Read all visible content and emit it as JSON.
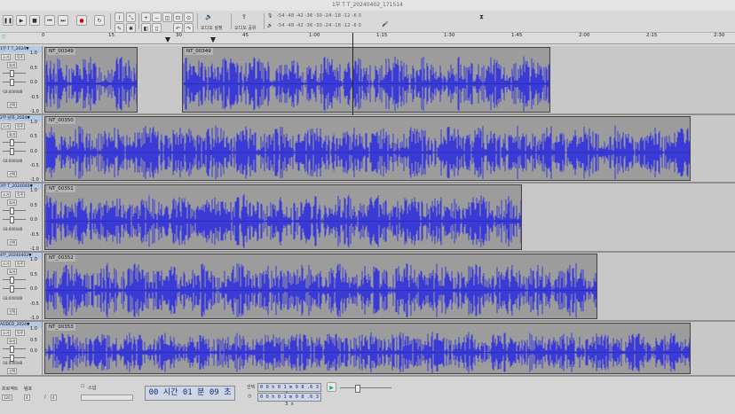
{
  "window": {
    "title": "1부 T T_20240402_171514"
  },
  "toolbar": {
    "audio_setup_label": "오디오 설정",
    "share_label": "오디오 공유",
    "meter_ticks": "-54 -48 -42 -36 -30 -24 -18 -12 -6 0"
  },
  "ruler": {
    "labels": [
      "0",
      "15",
      "30",
      "45",
      "1:00",
      "1:15",
      "1:30",
      "1:45",
      "2:00",
      "2:15",
      "2:30"
    ]
  },
  "tracks": [
    {
      "name": "1부 T T_2024▼",
      "mute": "소거",
      "solo": "독주",
      "effects": "효과",
      "gain": "-18.0000dB",
      "select": "선택",
      "scale": [
        "1.0",
        "0.5",
        "0.0",
        "-0.5",
        "-1.0"
      ],
      "clips": [
        {
          "name": "NT_00349"
        },
        {
          "name": "NT_00349"
        }
      ]
    },
    {
      "name": "2부 남자_2024▼",
      "mute": "소거",
      "solo": "독주",
      "effects": "효과",
      "gain": "-18.0000dB",
      "select": "선택",
      "scale": [
        "1.0",
        "0.5",
        "0.0",
        "-0.5",
        "-1.0"
      ],
      "clips": [
        {
          "name": "NT_00350"
        }
      ]
    },
    {
      "name": "3부 T_2024040▼",
      "mute": "소거",
      "solo": "독주",
      "effects": "효과",
      "gain": "-18.0000dB",
      "select": "선택",
      "scale": [
        "1.0",
        "0.5",
        "0.0",
        "-0.5",
        "-1.0"
      ],
      "clips": [
        {
          "name": "NT_00351"
        }
      ]
    },
    {
      "name": "4부_20240402▼",
      "mute": "소거",
      "solo": "독주",
      "effects": "효과",
      "gain": "-18.0000dB",
      "select": "선택",
      "scale": [
        "1.0",
        "0.5",
        "0.0",
        "-0.5",
        "-1.0"
      ],
      "clips": [
        {
          "name": "NT_00352"
        }
      ]
    },
    {
      "name": "ADDED_2024▼",
      "mute": "소거",
      "solo": "독주",
      "effects": "효과",
      "gain": "-18.0000dB",
      "select": "선택",
      "scale": [
        "1.0",
        "0.5",
        "0.0"
      ],
      "clips": [
        {
          "name": "NT_00353"
        }
      ]
    }
  ],
  "bottom": {
    "rate_label": "프로젝트",
    "rate_value": "44100",
    "tempo_label": "템포",
    "tempo_value": "120",
    "meter_label": "박자표",
    "meter_num": "4",
    "meter_den": "4",
    "snap_label": "스냅",
    "snap_value": "",
    "time_display": "00 시간 01 분 09 초",
    "selection_label": "선택",
    "sel_start": "0 0 h 0 1 m 0 8 .6 3 3 s",
    "sel_end": "0 0 h 0 1 m 0 8 .6 3 3 s"
  },
  "colors": {
    "wave": "#3a3ad6",
    "wave_dark": "#2020a0",
    "clip_bg": "#9c9c9c",
    "track_bg": "#c8c8c8"
  }
}
